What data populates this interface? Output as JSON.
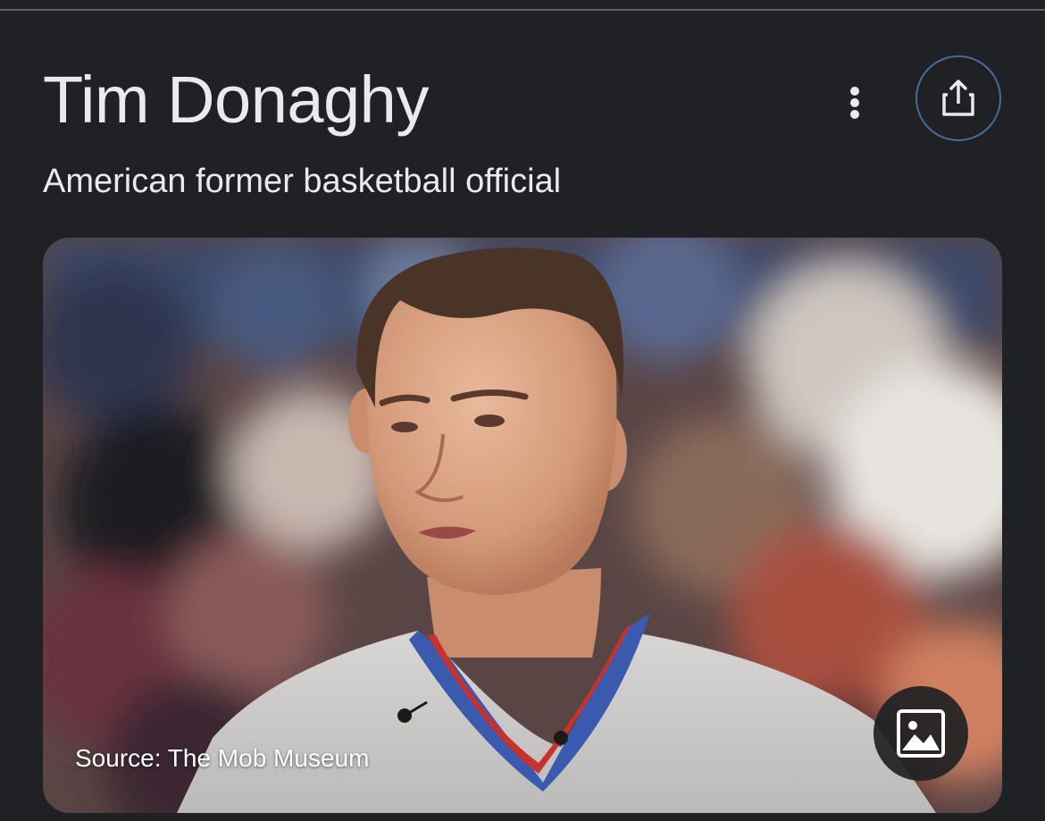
{
  "entity": {
    "title": "Tim Donaghy",
    "subtitle": "American former basketball official"
  },
  "actions": {
    "more_icon": "more-vert-icon",
    "share_icon": "share-icon"
  },
  "image": {
    "source_label": "Source: The Mob Museum",
    "image_icon": "image-icon",
    "alt": "Tim Donaghy"
  },
  "colors": {
    "background": "#202124",
    "text": "#e8eaed",
    "accent_border": "#4a6a9c"
  }
}
